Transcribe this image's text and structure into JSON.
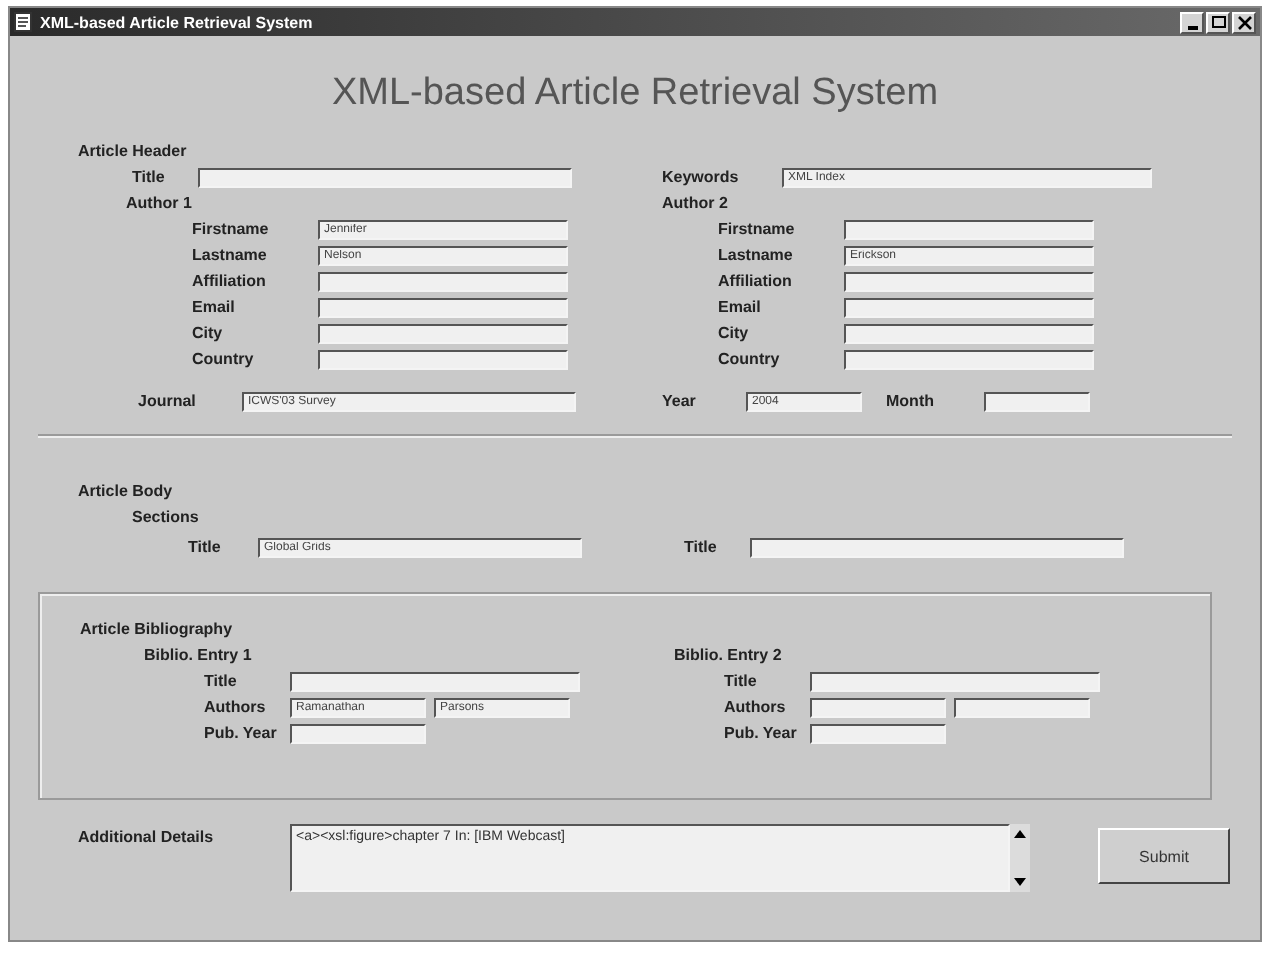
{
  "window": {
    "title": "XML-based Article Retrieval System"
  },
  "heading": "XML-based Article Retrieval System",
  "article_header": {
    "label": "Article Header",
    "title": {
      "label": "Title"
    },
    "keywords": {
      "label": "Keywords",
      "value": "XML Index"
    },
    "authors": [
      {
        "label": "Author 1",
        "fields": [
          {
            "label": "Firstname",
            "value": "Jennifer"
          },
          {
            "label": "Lastname",
            "value": "Nelson"
          },
          {
            "label": "Affiliation"
          },
          {
            "label": "Email"
          },
          {
            "label": "City"
          },
          {
            "label": "Country"
          }
        ]
      },
      {
        "label": "Author 2",
        "fields": [
          {
            "label": "Firstname"
          },
          {
            "label": "Lastname",
            "value": "Erickson"
          },
          {
            "label": "Affiliation"
          },
          {
            "label": "Email"
          },
          {
            "label": "City"
          },
          {
            "label": "Country"
          }
        ]
      }
    ],
    "journal": {
      "label": "Journal",
      "value": "ICWS'03 Survey"
    },
    "year": {
      "label": "Year",
      "value": "2004"
    },
    "month": {
      "label": "Month"
    }
  },
  "article_body": {
    "label": "Article Body",
    "sections_label": "Sections",
    "titles": [
      {
        "label": "Title",
        "value": "Global Grids"
      },
      {
        "label": "Title"
      }
    ]
  },
  "bibliography": {
    "label": "Article Bibliography",
    "entries": [
      {
        "label": "Biblio. Entry 1",
        "title": {
          "label": "Title"
        },
        "authors_label": "Authors",
        "authors": [
          "Ramanathan",
          "Parsons"
        ],
        "pub_year": {
          "label": "Pub. Year"
        }
      },
      {
        "label": "Biblio. Entry 2",
        "title": {
          "label": "Title"
        },
        "authors_label": "Authors",
        "pub_year": {
          "label": "Pub. Year"
        }
      }
    ]
  },
  "additional_details": {
    "label": "Additional Details",
    "value": "<a><xsl:figure>chapter 7 In: [IBM Webcast]"
  },
  "submit": "Submit"
}
